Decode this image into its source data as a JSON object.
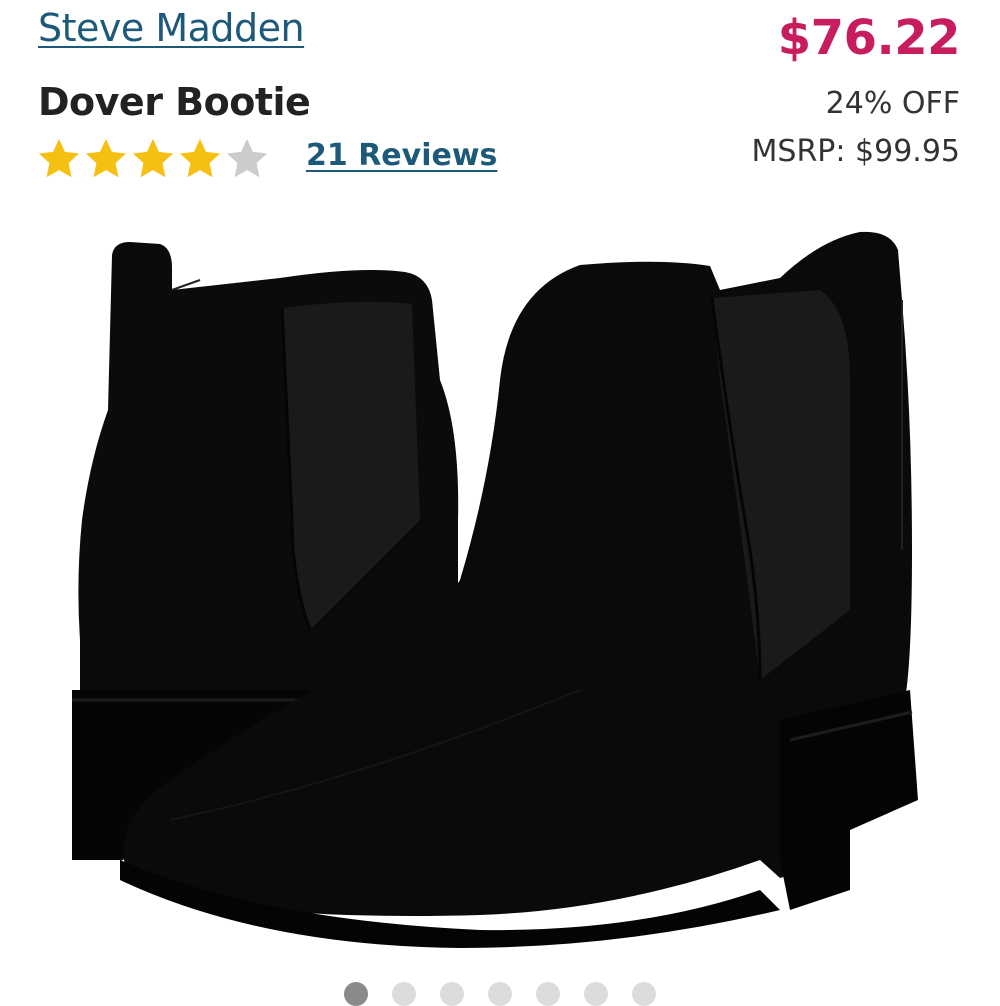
{
  "product": {
    "brand": "Steve Madden",
    "title": "Dover Bootie",
    "rating": {
      "value": 4,
      "max": 5,
      "reviews_label": "21 Reviews"
    },
    "pricing": {
      "price": "$76.22",
      "discount": "24% OFF",
      "msrp": "MSRP: $99.95"
    },
    "image": {
      "icon": "chelsea-boot-image"
    }
  },
  "carousel": {
    "dot_count": 7,
    "active_index": 0
  },
  "colors": {
    "link": "#1d5a7a",
    "price": "#c71d5e",
    "star_filled": "#f6c012",
    "star_empty": "#cccccc",
    "dot_active": "#8a8a8a",
    "dot_inactive": "#dcdcdc"
  }
}
